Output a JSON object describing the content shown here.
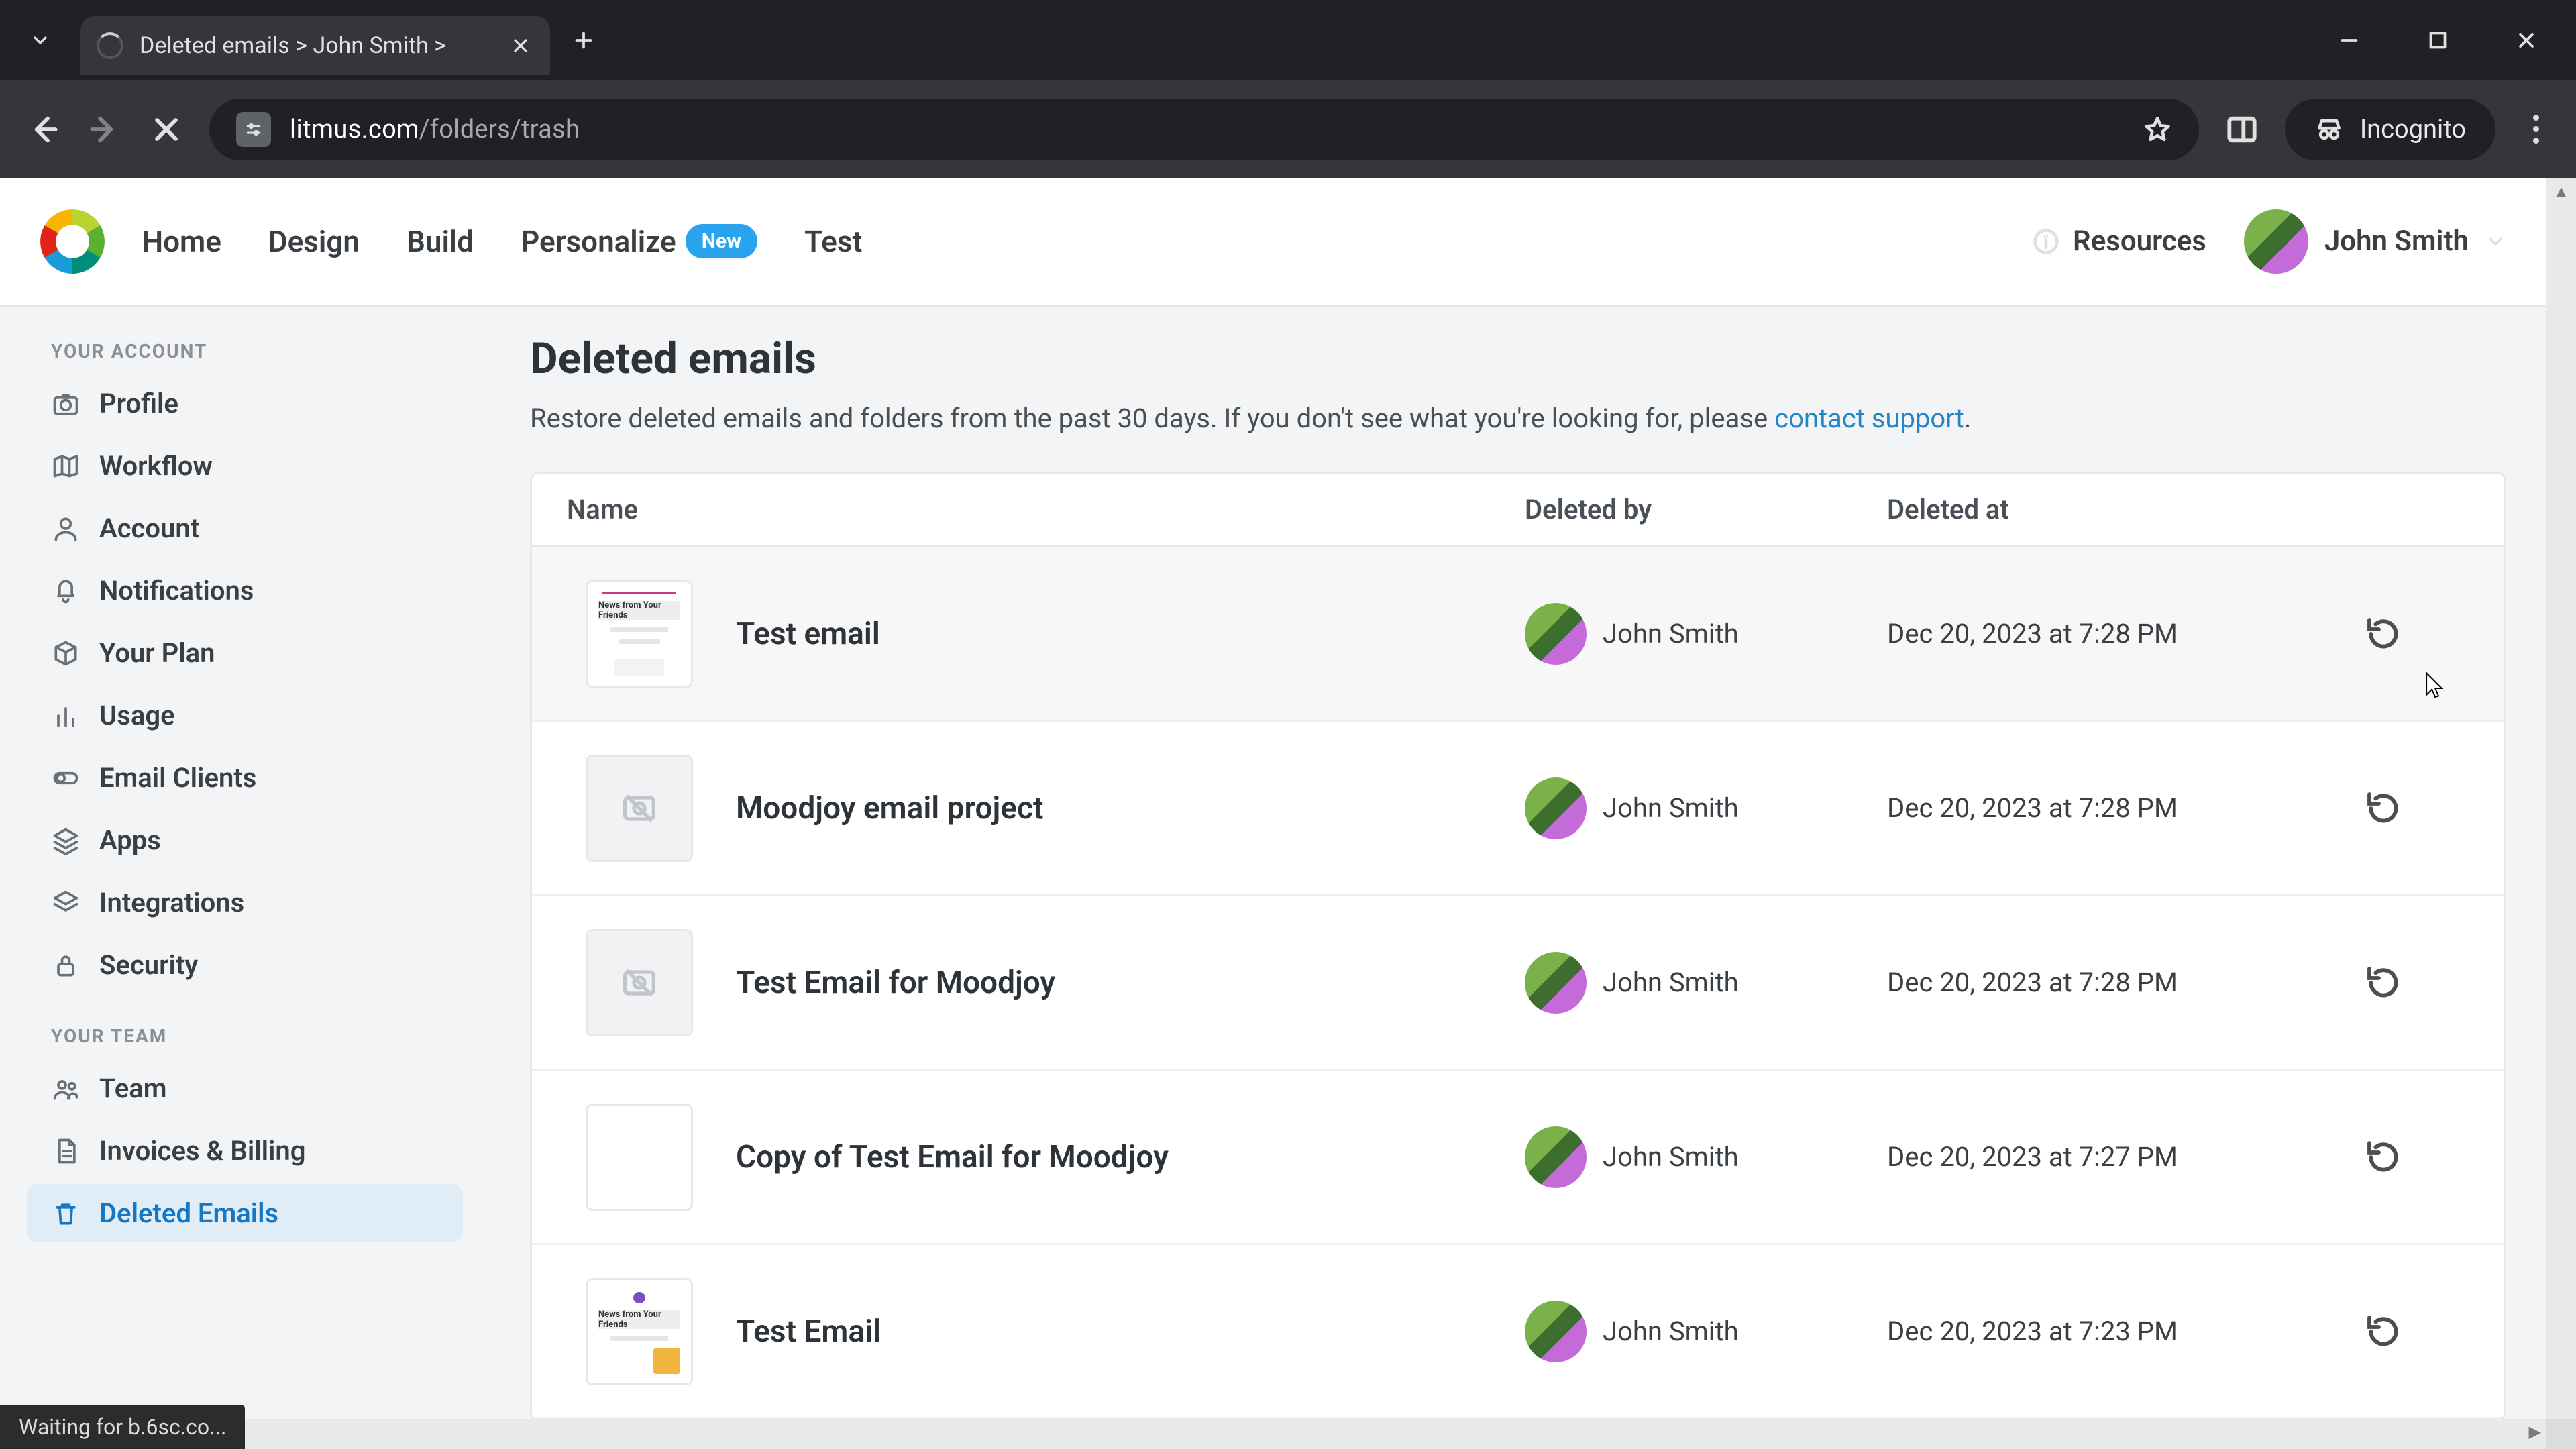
{
  "browser": {
    "tab_title": "Deleted emails > John Smith >",
    "url_domain": "litmus.com",
    "url_path": "/folders/trash",
    "incognito_label": "Incognito",
    "status_text": "Waiting for b.6sc.co..."
  },
  "header": {
    "nav": {
      "home": "Home",
      "design": "Design",
      "build": "Build",
      "personalize": "Personalize",
      "personalize_badge": "New",
      "test": "Test"
    },
    "resources_label": "Resources",
    "user_name": "John Smith"
  },
  "sidebar": {
    "section_account": "YOUR ACCOUNT",
    "section_team": "YOUR TEAM",
    "items": {
      "profile": "Profile",
      "workflow": "Workflow",
      "account": "Account",
      "notifications": "Notifications",
      "your_plan": "Your Plan",
      "usage": "Usage",
      "email_clients": "Email Clients",
      "apps": "Apps",
      "integrations": "Integrations",
      "security": "Security",
      "team": "Team",
      "invoices": "Invoices & Billing",
      "deleted_emails": "Deleted Emails"
    }
  },
  "main": {
    "title": "Deleted emails",
    "subtitle_prefix": "Restore deleted emails and folders from the past 30 days. If you don't see what you're looking for, please ",
    "subtitle_link": "contact support",
    "subtitle_suffix": ".",
    "columns": {
      "name": "Name",
      "deleted_by": "Deleted by",
      "deleted_at": "Deleted at"
    },
    "thumb_header_text": "News from Your Friends",
    "rows": [
      {
        "name": "Test email",
        "by": "John Smith",
        "at": "Dec 20, 2023 at 7:28 PM",
        "thumb": "doc-a",
        "hover": true
      },
      {
        "name": "Moodjoy email project",
        "by": "John Smith",
        "at": "Dec 20, 2023 at 7:28 PM",
        "thumb": "empty"
      },
      {
        "name": "Test Email for Moodjoy",
        "by": "John Smith",
        "at": "Dec 20, 2023 at 7:28 PM",
        "thumb": "empty"
      },
      {
        "name": "Copy of Test Email for Moodjoy",
        "by": "John Smith",
        "at": "Dec 20, 2023 at 7:27 PM",
        "thumb": "blank"
      },
      {
        "name": "Test Email",
        "by": "John Smith",
        "at": "Dec 20, 2023 at 7:23 PM",
        "thumb": "doc-b"
      }
    ]
  }
}
